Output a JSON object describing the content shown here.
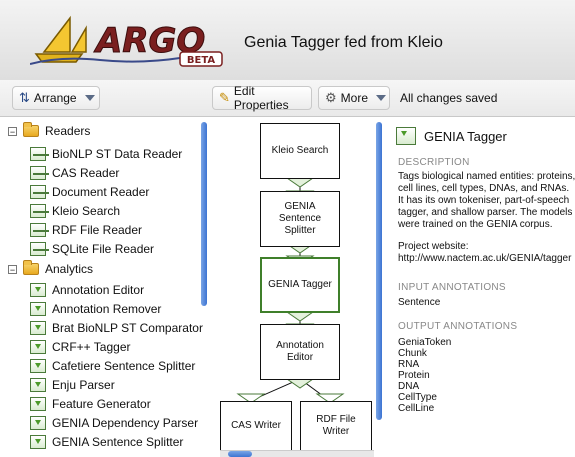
{
  "header": {
    "logo_text": "ARGO",
    "logo_badge": "BETA",
    "title": "Genia Tagger fed from Kleio"
  },
  "toolbar": {
    "arrange_label": "Arrange",
    "edit_label": "Edit Properties",
    "more_label": "More",
    "status": "All changes saved"
  },
  "tree": {
    "readers_label": "Readers",
    "readers": [
      "BioNLP ST Data Reader",
      "CAS Reader",
      "Document Reader",
      "Kleio Search",
      "RDF File Reader",
      "SQLite File Reader"
    ],
    "analytics_label": "Analytics",
    "analytics": [
      "Annotation Editor",
      "Annotation Remover",
      "Brat BioNLP ST Comparator",
      "CRF++ Tagger",
      "Cafetiere Sentence Splitter",
      "Enju Parser",
      "Feature Generator",
      "GENIA Dependency Parser",
      "GENIA Sentence Splitter"
    ]
  },
  "workflow": {
    "nodes": {
      "kleio": "Kleio Search",
      "splitter_1": "GENIA",
      "splitter_2": "Sentence",
      "splitter_3": "Splitter",
      "tagger": "GENIA Tagger",
      "editor_1": "Annotation",
      "editor_2": "Editor",
      "cas": "CAS Writer",
      "rdf_1": "RDF File",
      "rdf_2": "Writer"
    }
  },
  "details": {
    "title": "GENIA Tagger",
    "description_heading": "DESCRIPTION",
    "description_lines": [
      "Tags biological named entities: proteins,",
      "cell lines, cell types, DNAs, and RNAs.",
      "It has its own tokeniser, part-of-speech",
      "tagger, and shallow parser. The models",
      "were trained on the GENIA corpus."
    ],
    "website_label": "Project website:",
    "website_url": "http://www.nactem.ac.uk/GENIA/tagger",
    "input_heading": "INPUT ANNOTATIONS",
    "inputs": [
      "Sentence"
    ],
    "output_heading": "OUTPUT ANNOTATIONS",
    "outputs": [
      "GeniaToken",
      "Chunk",
      "RNA",
      "Protein",
      "DNA",
      "CellType",
      "CellLine"
    ]
  },
  "colors": {
    "accent_green": "#3f7f2a",
    "scroll_blue": "#3c74d2",
    "logo_gold": "#e0b21c"
  }
}
